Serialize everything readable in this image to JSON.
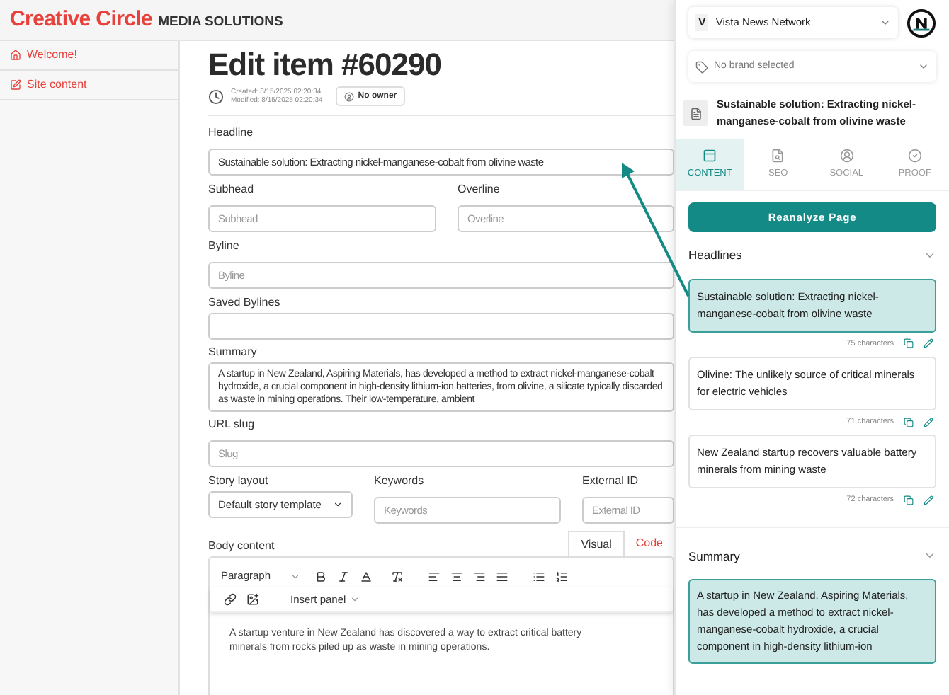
{
  "header": {
    "brand": "Creative Circle",
    "tagline": "MEDIA SOLUTIONS"
  },
  "sidebar": {
    "items": [
      {
        "kind": "home",
        "label": "Welcome!"
      },
      {
        "kind": "edit",
        "label": "Site content"
      }
    ]
  },
  "main": {
    "title": "Edit item #60290",
    "created": "Created: 8/15/2025 02:20:34",
    "modified": "Modified: 8/15/2025 02:20:34",
    "owner": "No owner",
    "headline": {
      "label": "Headline",
      "value": "Sustainable solution: Extracting nickel-manganese-cobalt from olivine waste"
    },
    "subhead": {
      "label": "Subhead",
      "placeholder": "Subhead"
    },
    "overline": {
      "label": "Overline",
      "placeholder": "Overline"
    },
    "byline": {
      "label": "Byline",
      "placeholder": "Byline"
    },
    "saved_bylines": {
      "label": "Saved Bylines"
    },
    "summary": {
      "label": "Summary",
      "value": "A startup in New Zealand, Aspiring Materials, has developed a method to extract nickel-manganese-cobalt hydroxide, a crucial component in high-density lithium-ion batteries, from olivine, a silicate typically discarded as waste in mining operations. Their low-temperature, ambient"
    },
    "url_slug": {
      "label": "URL slug",
      "placeholder": "Slug"
    },
    "story_layout": {
      "label": "Story layout",
      "value": "Default story template"
    },
    "keywords": {
      "label": "Keywords",
      "placeholder": "Keywords"
    },
    "external_id": {
      "label": "External ID",
      "placeholder": "External ID"
    },
    "body": {
      "label": "Body content",
      "tabs": [
        {
          "label": "Visual",
          "selected": true
        },
        {
          "label": "Code",
          "selected": false
        }
      ],
      "block_format": "Paragraph",
      "insert_panel": "Insert panel",
      "text": "A startup venture in New Zealand has discovered a way to extract critical battery minerals from rocks piled up as waste in mining operations."
    }
  },
  "assistant": {
    "network": {
      "initial": "V",
      "name": "Vista News Network"
    },
    "brand": {
      "placeholder": "No brand selected"
    },
    "article_title": "Sustainable solution: Extracting nickel-manganese-cobalt from olivine waste",
    "tabs": [
      {
        "kind": "content",
        "label": "CONTENT",
        "selected": true
      },
      {
        "kind": "seo",
        "label": "SEO",
        "selected": false
      },
      {
        "kind": "social",
        "label": "SOCIAL",
        "selected": false
      },
      {
        "kind": "proof",
        "label": "PROOF",
        "selected": false
      }
    ],
    "reanalyze": "Reanalyze Page",
    "headlines": {
      "title": "Headlines",
      "items": [
        {
          "text": "Sustainable solution: Extracting nickel-manganese-cobalt from olivine waste",
          "count": "75 characters",
          "selected": true
        },
        {
          "text": "Olivine: The unlikely source of critical minerals for electric vehicles",
          "count": "71 characters",
          "selected": false
        },
        {
          "text": "New Zealand startup recovers valuable battery minerals from mining waste",
          "count": "72 characters",
          "selected": false
        }
      ]
    },
    "summary": {
      "title": "Summary",
      "items": [
        {
          "text": "A startup in New Zealand, Aspiring Materials, has developed a method to extract nickel-manganese-cobalt hydroxide, a crucial component in high-density lithium-ion",
          "selected": true
        }
      ]
    }
  }
}
